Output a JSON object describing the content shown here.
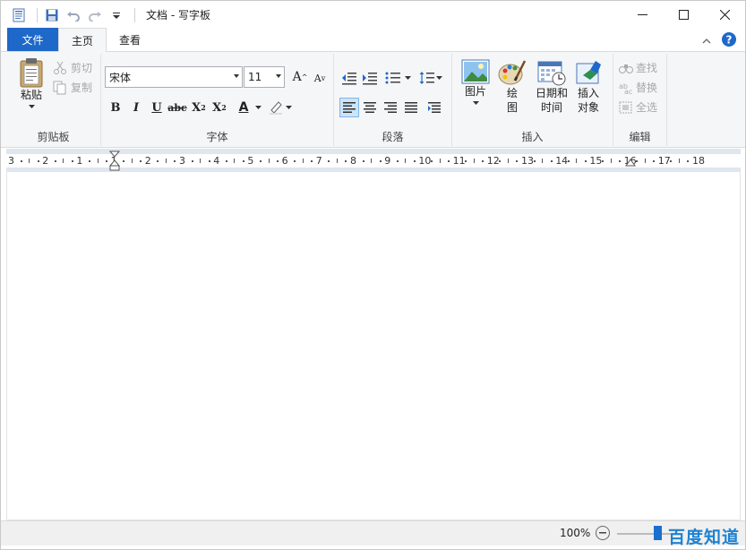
{
  "window": {
    "title": "文档 - 写字板",
    "minimize": "minimize-icon",
    "maximize": "maximize-icon",
    "close": "close-icon"
  },
  "tabs": [
    {
      "label": "文件"
    },
    {
      "label": "主页"
    },
    {
      "label": "查看"
    }
  ],
  "clipboard": {
    "group_label": "剪贴板",
    "paste_label": "粘贴",
    "cut_label": "剪切",
    "copy_label": "复制"
  },
  "font": {
    "group_label": "字体",
    "family_value": "宋体",
    "size_value": "11",
    "grow_label": "A",
    "shrink_label": "A",
    "bold": "B",
    "italic": "I",
    "underline": "U",
    "strike": "abc",
    "subscript": "X",
    "superscript": "X",
    "color_label": "A"
  },
  "paragraph": {
    "group_label": "段落"
  },
  "insert": {
    "group_label": "插入",
    "picture_label": "图片",
    "paint_label_1": "绘",
    "paint_label_2": "图",
    "datetime_label_1": "日期和",
    "datetime_label_2": "时间",
    "object_label_1": "插入",
    "object_label_2": "对象"
  },
  "editing": {
    "group_label": "编辑",
    "find_label": "查找",
    "replace_label": "替换",
    "selectall_label": "全选"
  },
  "ruler": {
    "numbers": [
      "3",
      "2",
      "1",
      "1",
      "2",
      "3",
      "4",
      "5",
      "6",
      "7",
      "8",
      "9",
      "10",
      "11",
      "12",
      "13",
      "14",
      "15",
      "16",
      "17",
      "18"
    ]
  },
  "status": {
    "zoom": "100%",
    "watermark": "百度知道"
  },
  "colors": {
    "file_tab": "#1e68c9",
    "ribbon_bg": "#f5f6f7",
    "accent_blue": "#1a6fd0"
  }
}
